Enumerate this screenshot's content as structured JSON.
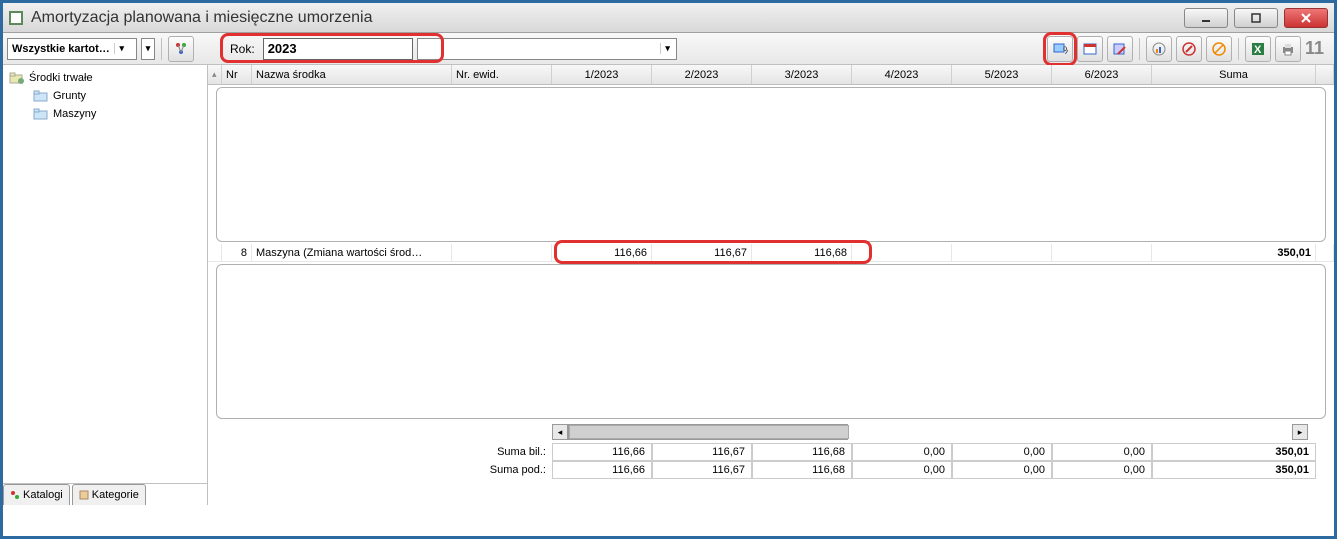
{
  "window": {
    "title": "Amortyzacja planowana i miesięczne umorzenia"
  },
  "toolbar": {
    "filter_combo": "Wszystkie kartot…",
    "year_label": "Rok:",
    "year_value": "2023",
    "record_count": "11"
  },
  "tree": {
    "root": "Środki trwałe",
    "children": [
      "Grunty",
      "Maszyny"
    ]
  },
  "left_tabs": {
    "katalogi": "Katalogi",
    "kategorie": "Kategorie"
  },
  "columns": {
    "nr": "Nr",
    "nazwa": "Nazwa środka",
    "ewid": "Nr. ewid.",
    "months": [
      "1/2023",
      "2/2023",
      "3/2023",
      "4/2023",
      "5/2023",
      "6/2023"
    ],
    "suma": "Suma"
  },
  "row": {
    "nr": "8",
    "nazwa": "Maszyna (Zmiana wartości środ…",
    "ewid": "",
    "months": [
      "116,66",
      "116,67",
      "116,68",
      "",
      "",
      ""
    ],
    "suma": "350,01"
  },
  "footer": {
    "suma_bil_label": "Suma bil.:",
    "suma_pod_label": "Suma pod.:",
    "bil": [
      "116,66",
      "116,67",
      "116,68",
      "0,00",
      "0,00",
      "0,00"
    ],
    "pod": [
      "116,66",
      "116,67",
      "116,68",
      "0,00",
      "0,00",
      "0,00"
    ],
    "bil_sum": "350,01",
    "pod_sum": "350,01"
  }
}
